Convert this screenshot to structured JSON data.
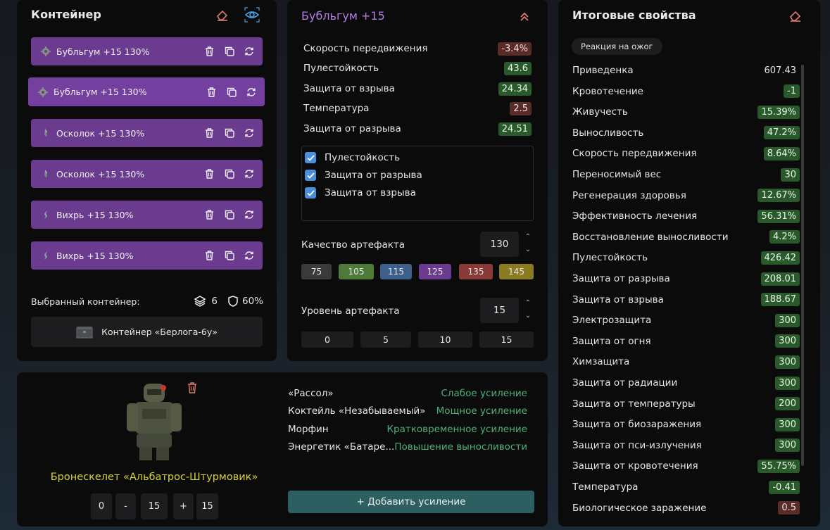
{
  "container": {
    "title": "Контейнер",
    "items": [
      {
        "label": "Бубльгум +15 130%",
        "icon": "gear-artifact-icon"
      },
      {
        "label": "Бубльгум +15 130%",
        "icon": "gear-artifact-icon"
      },
      {
        "label": "Осколок +15 130%",
        "icon": "shard-artifact-icon"
      },
      {
        "label": "Осколок +15 130%",
        "icon": "shard-artifact-icon"
      },
      {
        "label": "Вихрь +15 130%",
        "icon": "whirl-artifact-icon"
      },
      {
        "label": "Вихрь +15 130%",
        "icon": "whirl-artifact-icon"
      }
    ],
    "selected_label": "Выбранный контейнер:",
    "slots": "6",
    "protection": "60%",
    "container_name": "Контейнер «Берлога-6у»"
  },
  "artifact": {
    "title": "Бубльгум +15",
    "stats": [
      {
        "name": "Скорость передвижения",
        "value": "-3.4%",
        "tone": "red"
      },
      {
        "name": "Пулестойкость",
        "value": "43.6",
        "tone": "green"
      },
      {
        "name": "Защита от взрыва",
        "value": "24.34",
        "tone": "green"
      },
      {
        "name": "Температура",
        "value": "2.5",
        "tone": "red"
      },
      {
        "name": "Защита от разрыва",
        "value": "24.51",
        "tone": "green"
      }
    ],
    "checks": [
      "Пулестойкость",
      "Защита от разрыва",
      "Защита от взрыва"
    ],
    "quality_label": "Качество артефакта",
    "quality_value": "130",
    "quality_presets": [
      "75",
      "105",
      "115",
      "125",
      "135",
      "145"
    ],
    "level_label": "Уровень артефакта",
    "level_value": "15",
    "level_presets": [
      "0",
      "5",
      "10",
      "15"
    ]
  },
  "totals": {
    "title": "Итоговые свойства",
    "tag": "Реакция на ожог",
    "rows": [
      {
        "name": "Приведенка",
        "value": "607.43",
        "tone": "none"
      },
      {
        "name": "Кровотечение",
        "value": "-1",
        "tone": "green"
      },
      {
        "name": "Живучесть",
        "value": "15.39%",
        "tone": "green"
      },
      {
        "name": "Выносливость",
        "value": "47.2%",
        "tone": "green"
      },
      {
        "name": "Скорость передвижения",
        "value": "8.64%",
        "tone": "green"
      },
      {
        "name": "Переносимый вес",
        "value": "30",
        "tone": "green"
      },
      {
        "name": "Регенерация здоровья",
        "value": "12.67%",
        "tone": "green"
      },
      {
        "name": "Эффективность лечения",
        "value": "56.31%",
        "tone": "green"
      },
      {
        "name": "Восстановление выносливости",
        "value": "4.2%",
        "tone": "green"
      },
      {
        "name": "Пулестойкость",
        "value": "426.42",
        "tone": "green"
      },
      {
        "name": "Защита от разрыва",
        "value": "208.01",
        "tone": "green"
      },
      {
        "name": "Защита от взрыва",
        "value": "188.67",
        "tone": "green"
      },
      {
        "name": "Электрозащита",
        "value": "300",
        "tone": "green"
      },
      {
        "name": "Защита от огня",
        "value": "300",
        "tone": "green"
      },
      {
        "name": "Химзащита",
        "value": "300",
        "tone": "green"
      },
      {
        "name": "Защита от радиации",
        "value": "300",
        "tone": "green"
      },
      {
        "name": "Защита от температуры",
        "value": "200",
        "tone": "green"
      },
      {
        "name": "Защита от биозаражения",
        "value": "300",
        "tone": "green"
      },
      {
        "name": "Защита от пси-излучения",
        "value": "300",
        "tone": "green"
      },
      {
        "name": "Защита от кровотечения",
        "value": "55.75%",
        "tone": "green"
      },
      {
        "name": "Температура",
        "value": "-0.41",
        "tone": "green"
      },
      {
        "name": "Биологическое заражение",
        "value": "0.5",
        "tone": "red"
      }
    ]
  },
  "armor": {
    "name": "Бронескелет «Альбатрос-Штурмовик»",
    "controls": [
      "0",
      "-",
      "15",
      "+",
      "15"
    ],
    "boosts": [
      {
        "name": "«Рассол»",
        "effect": "Слабое усиление"
      },
      {
        "name": "Коктейль «Незабываемый»",
        "effect": "Мощное усиление"
      },
      {
        "name": "Морфин",
        "effect": "Кратковременное усиление"
      },
      {
        "name": "Энергетик «Батаре...",
        "effect": "Повышение выносливости"
      }
    ],
    "add_label": "+ Добавить усиление"
  },
  "colors": {
    "item_purple": "#6a3b8e",
    "accent_violet": "#b57be6",
    "badge_green": "#2a5a2c",
    "badge_red": "#5a2c28",
    "effect_green": "#4fb07a",
    "armor_yellow": "#d8d23a",
    "check_blue": "#4a8fd9",
    "preset_colors": [
      "#3a3a3d",
      "#4d7a38",
      "#3d5f8c",
      "#6a3b8e",
      "#8a3a36",
      "#8a7a22"
    ]
  }
}
